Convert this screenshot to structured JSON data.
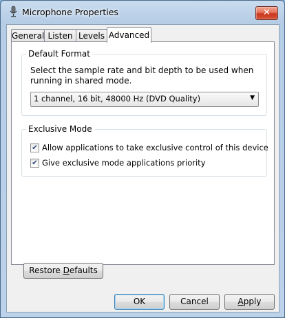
{
  "window": {
    "title": "Microphone Properties",
    "close_label": "✕"
  },
  "tabs": [
    {
      "label": "General",
      "active": false
    },
    {
      "label": "Listen",
      "active": false
    },
    {
      "label": "Levels",
      "active": false
    },
    {
      "label": "Advanced",
      "active": true
    }
  ],
  "default_format": {
    "legend": "Default Format",
    "description": "Select the sample rate and bit depth to be used when running in shared mode.",
    "selected": "1 channel, 16 bit, 48000 Hz (DVD Quality)"
  },
  "exclusive_mode": {
    "legend": "Exclusive Mode",
    "options": [
      {
        "label": "Allow applications to take exclusive control of this device",
        "checked": true
      },
      {
        "label": "Give exclusive mode applications priority",
        "checked": true
      }
    ]
  },
  "buttons": {
    "restore_pre": "Restore ",
    "restore_u": "D",
    "restore_post": "efaults",
    "ok": "OK",
    "cancel": "Cancel",
    "apply_u": "A",
    "apply_post": "pply"
  }
}
